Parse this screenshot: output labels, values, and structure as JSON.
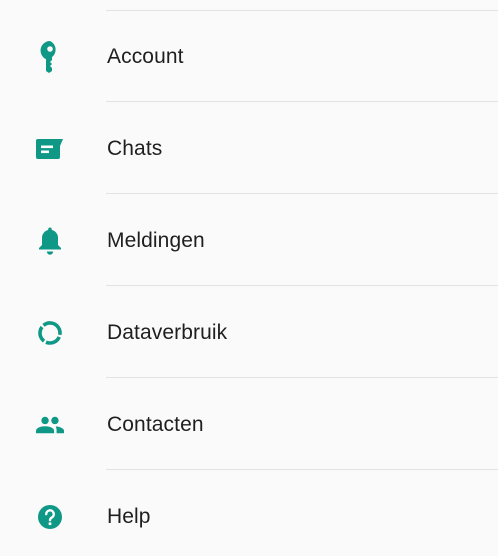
{
  "accent_color": "#0f9886",
  "settings": {
    "items": [
      {
        "label": "Account",
        "icon": "key-icon"
      },
      {
        "label": "Chats",
        "icon": "chat-icon"
      },
      {
        "label": "Meldingen",
        "icon": "bell-icon"
      },
      {
        "label": "Dataverbruik",
        "icon": "data-usage-icon"
      },
      {
        "label": "Contacten",
        "icon": "contacts-icon"
      },
      {
        "label": "Help",
        "icon": "help-icon"
      }
    ]
  }
}
